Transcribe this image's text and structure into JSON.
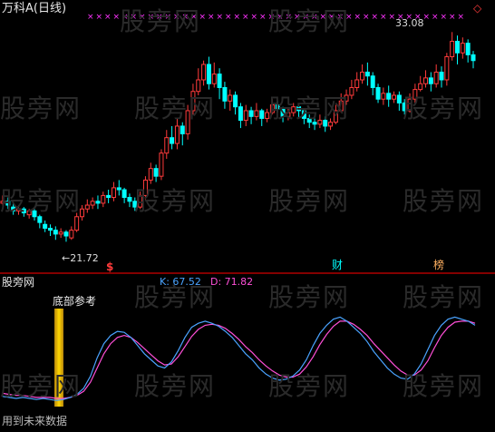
{
  "header": {
    "stock_title": "万科A(日线)",
    "top_marker_symbol": "×",
    "diamond_symbol": "◇"
  },
  "price_panel": {
    "high_label": "33.08",
    "low_label": "21.72",
    "event_tags": [
      "$",
      "财",
      "榜"
    ]
  },
  "indicator_panel": {
    "name": "股旁网",
    "k_label": "K: 67.52",
    "d_label": "D: 71.82",
    "bottom_ref_label": "底部参考",
    "footer_text": "用到未来数据"
  },
  "watermark": "股旁网",
  "colors": {
    "up": "#ff3b3b",
    "down": "#00ffff",
    "k_line": "#4aa3ff",
    "d_line": "#ff4fd8",
    "marker": "#ff33ff",
    "signal_bar": "#ffd700",
    "divider": "#b00000"
  },
  "chart_data": {
    "type": "candlestick",
    "series": [
      {
        "name": "K",
        "value": 67.52
      },
      {
        "name": "D",
        "value": 71.82
      }
    ],
    "price_high": 33.08,
    "price_low": 21.72,
    "candles": [
      [
        24.2,
        24.3,
        24.6,
        23.9
      ],
      [
        24.3,
        24.1,
        24.5,
        23.9
      ],
      [
        24.0,
        23.8,
        24.2,
        23.6
      ],
      [
        23.8,
        23.9,
        24.1,
        23.6
      ],
      [
        23.9,
        23.7,
        24.0,
        23.5
      ],
      [
        23.6,
        23.8,
        23.9,
        23.4
      ],
      [
        23.8,
        23.5,
        23.9,
        23.3
      ],
      [
        23.5,
        23.2,
        23.6,
        22.9
      ],
      [
        23.1,
        22.9,
        23.3,
        22.7
      ],
      [
        22.9,
        22.8,
        23.1,
        22.5
      ],
      [
        22.8,
        22.6,
        23.0,
        22.3
      ],
      [
        22.6,
        22.7,
        22.9,
        22.4
      ],
      [
        22.7,
        22.5,
        22.8,
        22.2
      ],
      [
        22.4,
        22.8,
        23.0,
        22.3
      ],
      [
        22.8,
        23.5,
        23.7,
        22.7
      ],
      [
        23.5,
        23.9,
        24.1,
        23.3
      ],
      [
        23.9,
        24.1,
        24.4,
        23.7
      ],
      [
        24.1,
        24.3,
        24.5,
        23.9
      ],
      [
        24.3,
        24.2,
        24.6,
        23.9
      ],
      [
        24.2,
        24.6,
        24.8,
        24.0
      ],
      [
        24.6,
        24.5,
        24.9,
        24.2
      ],
      [
        24.5,
        25.0,
        25.3,
        24.3
      ],
      [
        25.0,
        24.9,
        25.4,
        24.6
      ],
      [
        24.9,
        24.5,
        25.0,
        24.2
      ],
      [
        24.5,
        24.3,
        24.7,
        24.0
      ],
      [
        24.3,
        24.0,
        24.5,
        23.8
      ],
      [
        24.0,
        24.6,
        24.8,
        23.9
      ],
      [
        24.6,
        25.4,
        25.6,
        24.4
      ],
      [
        25.4,
        26.0,
        26.3,
        25.2
      ],
      [
        26.0,
        25.6,
        26.2,
        25.3
      ],
      [
        25.6,
        26.8,
        27.0,
        25.4
      ],
      [
        26.8,
        27.6,
        28.0,
        26.5
      ],
      [
        27.6,
        27.3,
        28.2,
        27.0
      ],
      [
        27.3,
        28.2,
        28.6,
        27.0
      ],
      [
        28.2,
        27.8,
        28.4,
        27.2
      ],
      [
        27.8,
        29.0,
        29.3,
        27.5
      ],
      [
        29.0,
        30.0,
        30.4,
        28.8
      ],
      [
        30.0,
        30.6,
        31.2,
        29.8
      ],
      [
        30.6,
        31.4,
        31.6,
        30.3
      ],
      [
        31.4,
        30.4,
        31.8,
        30.1
      ],
      [
        30.4,
        30.9,
        31.5,
        30.2
      ],
      [
        30.9,
        30.2,
        31.2,
        29.6
      ],
      [
        30.2,
        29.5,
        30.5,
        29.1
      ],
      [
        29.5,
        29.8,
        30.1,
        29.0
      ],
      [
        29.8,
        29.2,
        30.0,
        28.8
      ],
      [
        29.2,
        28.5,
        29.4,
        28.1
      ],
      [
        28.5,
        29.0,
        29.3,
        28.2
      ],
      [
        29.0,
        28.7,
        29.2,
        28.3
      ],
      [
        28.7,
        29.0,
        29.4,
        28.5
      ],
      [
        29.0,
        28.6,
        29.1,
        28.2
      ],
      [
        28.6,
        28.9,
        29.1,
        28.4
      ],
      [
        28.9,
        29.3,
        29.6,
        28.8
      ],
      [
        29.3,
        29.1,
        29.5,
        28.9
      ],
      [
        29.1,
        28.7,
        29.2,
        28.4
      ],
      [
        28.7,
        28.9,
        29.1,
        28.5
      ],
      [
        28.9,
        29.2,
        29.4,
        28.7
      ],
      [
        29.2,
        29.0,
        29.3,
        28.6
      ],
      [
        29.0,
        28.6,
        29.1,
        28.3
      ],
      [
        28.6,
        28.4,
        28.8,
        28.1
      ],
      [
        28.4,
        28.3,
        28.6,
        28.0
      ],
      [
        28.3,
        28.5,
        28.8,
        28.1
      ],
      [
        28.5,
        28.2,
        28.7,
        27.9
      ],
      [
        28.2,
        28.4,
        28.6,
        28.0
      ],
      [
        28.4,
        29.0,
        29.3,
        28.3
      ],
      [
        29.0,
        29.5,
        29.9,
        28.9
      ],
      [
        29.5,
        29.8,
        30.1,
        29.3
      ],
      [
        29.8,
        30.2,
        30.6,
        29.6
      ],
      [
        30.2,
        30.6,
        31.0,
        30.0
      ],
      [
        30.6,
        31.0,
        31.4,
        30.4
      ],
      [
        31.0,
        30.8,
        31.5,
        30.3
      ],
      [
        30.8,
        30.2,
        31.0,
        29.8
      ],
      [
        30.2,
        29.6,
        30.4,
        29.4
      ],
      [
        29.6,
        29.9,
        30.2,
        29.3
      ],
      [
        29.9,
        29.6,
        30.3,
        29.2
      ],
      [
        29.6,
        29.8,
        30.0,
        29.4
      ],
      [
        29.8,
        29.4,
        30.0,
        29.0
      ],
      [
        29.4,
        29.0,
        29.6,
        28.8
      ],
      [
        29.0,
        29.6,
        29.9,
        28.9
      ],
      [
        29.6,
        30.1,
        30.4,
        29.4
      ],
      [
        30.1,
        30.4,
        30.8,
        30.0
      ],
      [
        30.4,
        30.7,
        31.1,
        30.2
      ],
      [
        30.7,
        30.4,
        31.0,
        30.0
      ],
      [
        30.4,
        31.0,
        31.4,
        30.2
      ],
      [
        31.0,
        30.6,
        31.3,
        30.2
      ],
      [
        30.6,
        31.8,
        32.0,
        30.3
      ],
      [
        31.8,
        32.6,
        33.08,
        31.6
      ],
      [
        32.6,
        32.0,
        32.9,
        31.4
      ],
      [
        32.0,
        32.5,
        32.8,
        31.7
      ],
      [
        32.5,
        31.9,
        32.7,
        31.5
      ],
      [
        31.9,
        31.6,
        32.1,
        31.2
      ]
    ],
    "k_values": [
      10,
      9,
      8,
      9,
      8,
      7,
      8,
      7,
      6,
      7,
      9,
      12,
      18,
      30,
      48,
      62,
      70,
      74,
      73,
      68,
      60,
      52,
      46,
      40,
      38,
      44,
      55,
      68,
      78,
      82,
      84,
      82,
      79,
      74,
      68,
      60,
      52,
      46,
      38,
      32,
      28,
      26,
      27,
      30,
      36,
      46,
      60,
      72,
      80,
      86,
      88,
      84,
      78,
      72,
      64,
      54,
      46,
      38,
      32,
      28,
      27,
      32,
      42,
      56,
      70,
      80,
      86,
      88,
      86,
      84,
      80
    ],
    "d_values": [
      13,
      12,
      11,
      11,
      10,
      9,
      9,
      9,
      8,
      8,
      9,
      11,
      15,
      24,
      38,
      52,
      62,
      68,
      70,
      68,
      63,
      57,
      51,
      45,
      41,
      42,
      49,
      59,
      69,
      76,
      80,
      81,
      80,
      77,
      72,
      66,
      59,
      53,
      46,
      40,
      35,
      31,
      29,
      29,
      32,
      39,
      49,
      61,
      71,
      79,
      84,
      84,
      81,
      76,
      70,
      62,
      55,
      48,
      41,
      35,
      31,
      31,
      36,
      45,
      58,
      70,
      78,
      83,
      84,
      84,
      82
    ],
    "bottom_signal_index": 4
  }
}
